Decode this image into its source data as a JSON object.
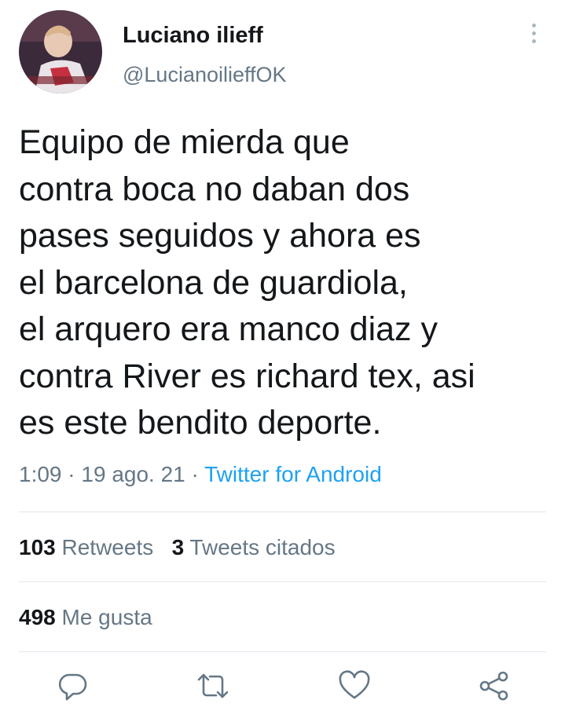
{
  "user": {
    "display_name": "Luciano ilieff",
    "handle": "@LucianoilieffOK"
  },
  "tweet": {
    "lines": [
      "Equipo de mierda que",
      "contra boca no daban dos",
      "pases seguidos y ahora es",
      "el barcelona de guardiola,",
      "el arquero era manco diaz y",
      "contra River es richard tex, asi",
      "es este bendito deporte."
    ]
  },
  "meta": {
    "time": "1:09",
    "separator": " · ",
    "date": "19 ago. 21",
    "source": "Twitter for Android"
  },
  "stats": {
    "retweets_count": "103",
    "retweets_label": "Retweets",
    "quotes_count": "3",
    "quotes_label": "Tweets citados",
    "likes_count": "498",
    "likes_label": "Me gusta"
  },
  "icons": {
    "reply": "reply-icon",
    "retweet": "retweet-icon",
    "like": "heart-icon",
    "share": "share-icon",
    "more": "more-vertical-icon"
  },
  "colors": {
    "text": "#14171a",
    "secondary": "#657786",
    "accent": "#1da1f2",
    "divider": "#e1e8ed"
  }
}
